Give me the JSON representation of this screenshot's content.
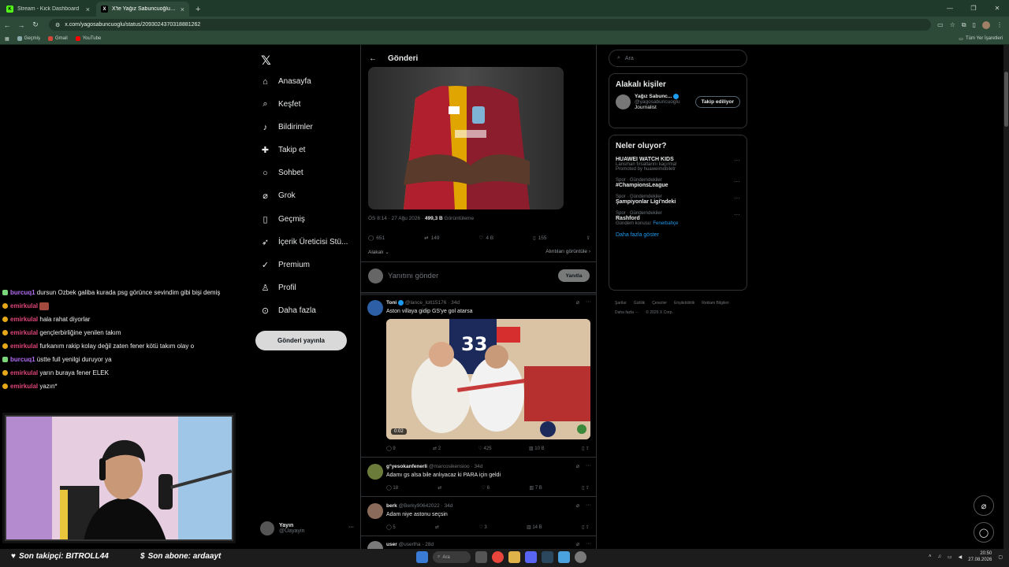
{
  "browser": {
    "tabs": [
      {
        "title": "Stream - Kick Dashboard",
        "icon": "kick-icon",
        "color": "#53fc18",
        "letter": "K"
      },
      {
        "title": "X'te Yağız Sabuncuoğlu: \"RAFA...",
        "icon": "x-icon",
        "color": "#ffffff",
        "letter": "X"
      }
    ],
    "url": "x.com/yagosabuncuoglu/status/2093024370318881262",
    "bookmarks": [
      "Geçmiş",
      "Gmail",
      "YouTube"
    ],
    "bookmarks_right": "Tüm Yer İşaretleri"
  },
  "nav": {
    "items": [
      {
        "label": "Anasayfa",
        "icon": "home-icon",
        "glyph": "⌂"
      },
      {
        "label": "Keşfet",
        "icon": "search-icon",
        "glyph": "⌕"
      },
      {
        "label": "Bildirimler",
        "icon": "bell-icon",
        "glyph": "♪"
      },
      {
        "label": "Takip et",
        "icon": "add-user-icon",
        "glyph": "+"
      },
      {
        "label": "Sohbet",
        "icon": "chat-icon",
        "glyph": "○"
      },
      {
        "label": "Grok",
        "icon": "grok-icon",
        "glyph": "⌀"
      },
      {
        "label": "Geçmiş",
        "icon": "bookmark-icon",
        "glyph": "▯"
      },
      {
        "label": "İçerik Üreticisi Stü...",
        "icon": "rocket-icon",
        "glyph": "➶"
      },
      {
        "label": "Premium",
        "icon": "premium-icon",
        "glyph": "✓"
      },
      {
        "label": "Profil",
        "icon": "profile-icon",
        "glyph": "♙"
      },
      {
        "label": "Daha fazla",
        "icon": "more-icon",
        "glyph": "⋯"
      }
    ],
    "post_button": "Gönderi yayınla",
    "profile_name": "Yayın",
    "profile_handle": "@Uayayin"
  },
  "post": {
    "header_title": "Gönderi",
    "time": "ÖS 8:14 · 27 Ağu 2026 · ",
    "views": "499,3 B",
    "views_label": " Görüntüleme",
    "replies": "651",
    "reposts": "149",
    "likes": "4 B",
    "bookmarks": "155",
    "related": "Alakalı",
    "quotes": "Alıntıları görüntüle",
    "reply_placeholder": "Yanıtını gönder",
    "reply_button": "Yanıtla"
  },
  "replies": [
    {
      "name": "Toni",
      "handle": "@lance_lott15176 · 34d",
      "text": "Aston villaya gidip GS'ye gol atarsa",
      "replies": "9",
      "reposts": "2",
      "likes": "425",
      "views": "10 B",
      "video_duration": "0:02",
      "avatar_color": "#2d5fa6"
    },
    {
      "name": "g°yesokanfenerli",
      "handle": "@marcosikensioo · 34d",
      "text": "Adamı gs alsa bile anlıyacaz ki PARA için geldi",
      "replies": "18",
      "reposts": "",
      "likes": "6",
      "views": "7 B",
      "avatar_color": "#6b7b3a"
    },
    {
      "name": "berk",
      "handle": "@Berky90642022 · 34d",
      "text": "Adam niye astonu seçsin",
      "replies": "5",
      "reposts": "",
      "likes": "3",
      "views": "14 B",
      "avatar_color": "#8a6a5a"
    },
    {
      "name": "user",
      "handle": "@userlha · 28d",
      "text": "",
      "avatar_color": "#7a7a7a"
    }
  ],
  "sidebar": {
    "search_placeholder": "Ara",
    "people_title": "Alakalı kişiler",
    "person_name": "Yağız Sabunc...",
    "person_handle": "@yagosabuncuoglu",
    "person_bio": "Journalist",
    "follow_label": "Takip ediliyor",
    "trends_title": "Neler oluyor?",
    "trends": [
      {
        "category": "",
        "title": "HUAWEI WATCH KIDS",
        "sub": "Lansman fırsatlarını kaçırma!",
        "extra": "Promoted by huaweimobiletr"
      },
      {
        "category": "Spor · Gündemdekiler",
        "title": "#ChampionsLeague",
        "sub": "",
        "extra": ""
      },
      {
        "category": "Spor · Gündemdekiler",
        "title": "Şampiyonlar Ligi'ndeki",
        "sub": "",
        "extra": ""
      },
      {
        "category": "Spor · Gündemdekiler",
        "title": "Rashford",
        "sub": "Gündem konusu: ",
        "extra": "Fenerbahçe"
      }
    ],
    "show_more": "Daha fazla göster",
    "footer": [
      "Şartlar",
      "Gizlilik",
      "Çerezler",
      "Erişilebilirlik",
      "Reklam Bilgileri",
      "Daha fazla ···",
      "© 2026 X Corp."
    ]
  },
  "chat": [
    {
      "user": "burcuq1",
      "color": "purple",
      "badge": "sub",
      "text": "dursun Ozbek galiba kurada psg görünce sevindim gibi bişi demiş"
    },
    {
      "user": "emirkulal",
      "color": "pink",
      "badge": "gold",
      "text": "",
      "emote": true
    },
    {
      "user": "emirkulal",
      "color": "pink",
      "badge": "gold",
      "text": "hala rahat diyorlar"
    },
    {
      "user": "emirkulal",
      "color": "pink",
      "badge": "gold",
      "text": "gençlerbirliğine yenilen takım"
    },
    {
      "user": "emirkulal",
      "color": "pink",
      "badge": "gold",
      "text": "furkanım rakip kolay değil zaten fener kötü takım olay o"
    },
    {
      "user": "burcuq1",
      "color": "purple",
      "badge": "sub",
      "text": "üstte full yenilgi duruyor ya"
    },
    {
      "user": "emirkulal",
      "color": "pink",
      "badge": "gold",
      "text": "yarın buraya fener ELEK"
    },
    {
      "user": "emirkulal",
      "color": "pink",
      "badge": "gold",
      "text": "yazın*"
    }
  ],
  "overlay": {
    "last_follower": "Son takipçi: BITROLL44",
    "last_sub": "Son abone: ardaayt"
  },
  "taskbar": {
    "search": "Ara",
    "time": "20:50",
    "date": "27.08.2026"
  }
}
